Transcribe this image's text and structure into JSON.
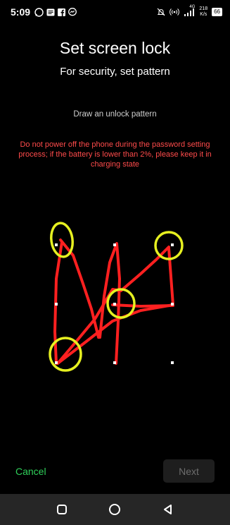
{
  "status_bar": {
    "time": "5:09",
    "network_type": "4G",
    "speed_value": "218",
    "speed_unit": "K/s",
    "battery": "66",
    "icons": [
      "whatsapp-icon",
      "message-icon",
      "facebook-icon",
      "messenger-icon",
      "mute-icon",
      "hotspot-icon",
      "signal-icon",
      "battery-icon"
    ]
  },
  "header": {
    "title": "Set screen lock",
    "subtitle": "For security, set pattern"
  },
  "hint": "Draw an unlock pattern",
  "warning": "Do not power off the phone during the password setting process; if the battery is lower than 2%, please keep it in charging state",
  "pattern": {
    "grid": "3x3",
    "dot_color": "#ffffff",
    "stroke_color": "#ff2020",
    "highlight_color": "#e6f020"
  },
  "footer": {
    "cancel_label": "Cancel",
    "next_label": "Next",
    "cancel_color": "#2fd05a"
  },
  "navbar": {
    "icons": [
      "recents-icon",
      "home-icon",
      "back-icon"
    ]
  }
}
